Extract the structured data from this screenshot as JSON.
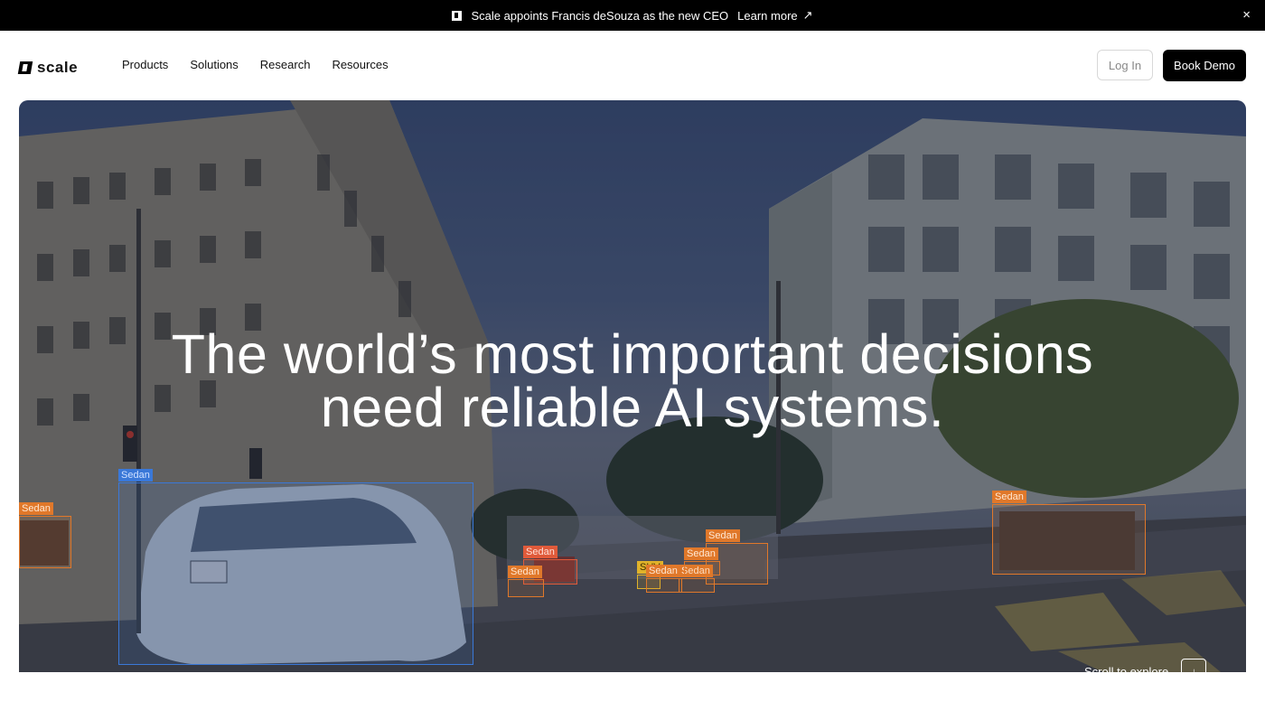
{
  "announcement": {
    "text": "Scale appoints Francis deSouza as the new CEO",
    "link_label": "Learn more",
    "link_icon": "↗",
    "close_icon": "×"
  },
  "nav": {
    "brand": "scale",
    "items": [
      "Products",
      "Solutions",
      "Research",
      "Resources"
    ],
    "login_label": "Log In",
    "demo_label": "Book Demo"
  },
  "hero": {
    "headline_line1": "The world’s most important decisions",
    "headline_line2": "need reliable AI systems.",
    "detections": [
      "Sedan",
      "Sedan",
      "Sedan",
      "Sedan",
      "Sedan",
      "SUV",
      "Sedan",
      "Sedan",
      "Sedan",
      "Sedan"
    ],
    "scroll_label": "Scroll to explore",
    "scroll_icon": "↓"
  },
  "colors": {
    "accent": "#000000",
    "bbox_blue": "#3a78d8",
    "bbox_orange": "#e0782a"
  }
}
